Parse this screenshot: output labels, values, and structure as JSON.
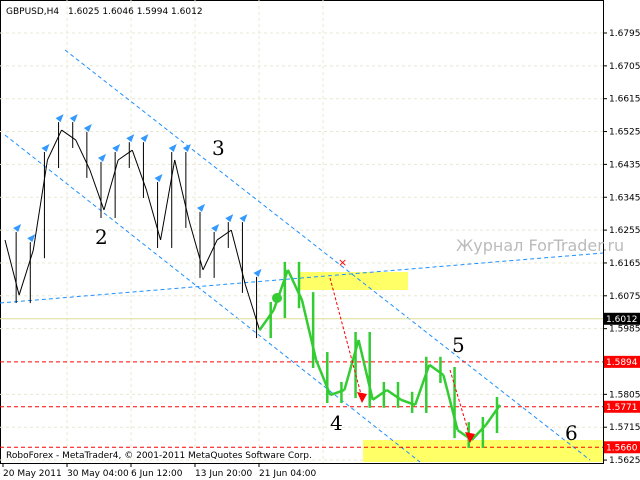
{
  "header": {
    "symbol": "GBPUSD,H4",
    "ohlc": "1.6025 1.6046 1.5994 1.6012"
  },
  "footer": {
    "copyright": "RoboForex - MetaTrader4, © 2001-2011 MetaQuotes Software Corp."
  },
  "watermark": "Журнал ForTrader.ru",
  "colors": {
    "line": "#33cc33",
    "candles": "#000000",
    "level": "#ff0000",
    "channel": "#1e90ff",
    "zone": "#ffff66"
  },
  "chart_data": {
    "type": "line",
    "title": "GBPUSD,H4",
    "ylim": [
      1.5625,
      1.684
    ],
    "y_ticks": [
      "1.6795",
      "1.6705",
      "1.6615",
      "1.6525",
      "1.6435",
      "1.6345",
      "1.6255",
      "1.6165",
      "1.6075",
      "1.5985",
      "1.5805",
      "1.5715",
      "1.5625"
    ],
    "x_ticks": [
      "20 May 2011",
      "30 May 04:00",
      "6 Jun 12:00",
      "13 Jun 20:00",
      "21 Jun 04:00"
    ],
    "close": [
      1.6228,
      1.6077,
      1.62,
      1.6447,
      1.6529,
      1.6502,
      1.642,
      1.631,
      1.6447,
      1.6474,
      1.6365,
      1.6228,
      1.6447,
      1.6283,
      1.6146,
      1.6228,
      1.6255,
      1.6105,
      1.5981,
      1.6036,
      1.6146,
      1.6063,
      1.5899,
      1.5803,
      1.5817,
      1.5954,
      1.579,
      1.5817,
      1.579,
      1.5776,
      1.5886,
      1.5858,
      1.5707,
      1.568,
      1.5721,
      1.5776
    ],
    "candle_count": 18,
    "current_price": "1.6012",
    "levels": [
      {
        "value": 1.5894,
        "label": "1.5894"
      },
      {
        "value": 1.5771,
        "label": "1.5771"
      },
      {
        "value": 1.566,
        "label": "1.5660"
      }
    ],
    "annotations": [
      "2",
      "3",
      "4",
      "5",
      "6"
    ]
  }
}
